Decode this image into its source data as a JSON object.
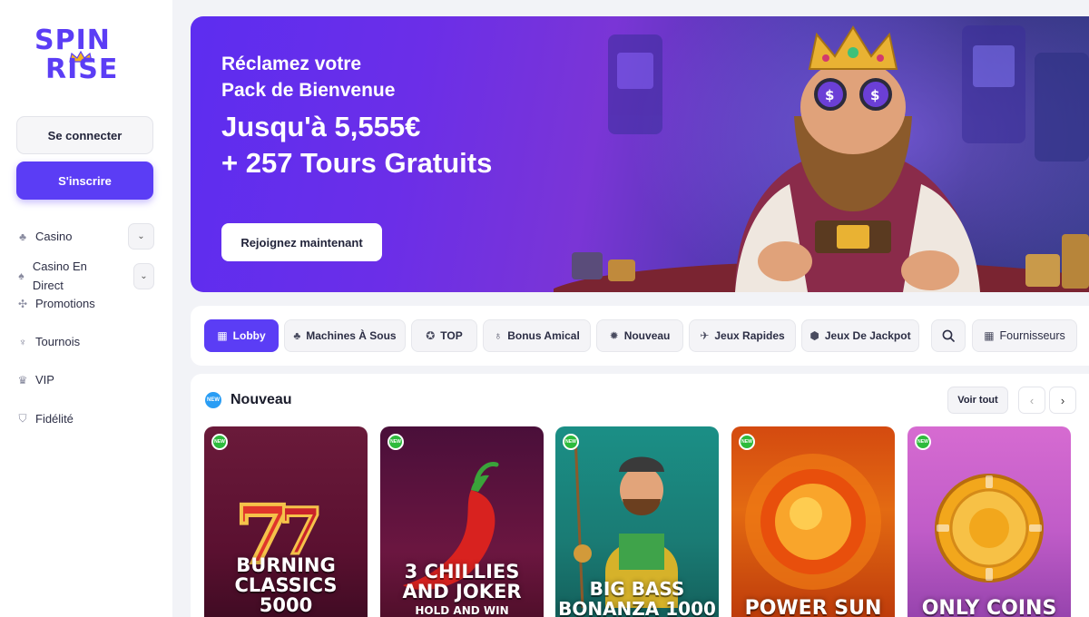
{
  "brand": {
    "line1": "SPIN",
    "line2": "RISE",
    "accent": "#5b3df5"
  },
  "auth": {
    "login_label": "Se connecter",
    "signup_label": "S'inscrire"
  },
  "sidebar": {
    "items": [
      {
        "label": "Casino",
        "icon": "cards-icon",
        "expandable": true
      },
      {
        "label": "Casino En Direct",
        "icon": "spade-icon",
        "expandable": true
      },
      {
        "label": "Promotions",
        "icon": "gift-icon",
        "expandable": false
      },
      {
        "label": "Tournois",
        "icon": "trophy-icon",
        "expandable": false
      },
      {
        "label": "VIP",
        "icon": "crown-icon",
        "expandable": false
      },
      {
        "label": "Fidélité",
        "icon": "shield-icon",
        "expandable": false
      }
    ]
  },
  "hero": {
    "line1": "Réclamez votre",
    "line2": "Pack de Bienvenue",
    "offer1": "Jusqu'à 5,555€",
    "offer2": "+ 257 Tours Gratuits",
    "cta_label": "Rejoignez maintenant"
  },
  "categories": {
    "tabs": [
      {
        "label": "Lobby",
        "icon": "lobby-icon",
        "active": true
      },
      {
        "label": "Machines À Sous",
        "icon": "cherry-icon",
        "active": false
      },
      {
        "label": "TOP",
        "icon": "medal-icon",
        "active": false
      },
      {
        "label": "Bonus Amical",
        "icon": "moneybag-icon",
        "active": false
      },
      {
        "label": "Nouveau",
        "icon": "new-icon",
        "active": false
      },
      {
        "label": "Jeux Rapides",
        "icon": "plane-icon",
        "active": false
      },
      {
        "label": "Jeux De Jackpot",
        "icon": "jackpot-icon",
        "active": false
      }
    ],
    "search_icon": "search-icon",
    "providers_label": "Fournisseurs"
  },
  "new_section": {
    "title": "Nouveau",
    "badge_text": "NEW",
    "see_all_label": "Voir tout",
    "games": [
      {
        "title_lines": [
          "BURNING",
          "CLASSICS",
          "5000"
        ],
        "subtitle": "",
        "badge": "NEW"
      },
      {
        "title_lines": [
          "3 CHILLIES",
          "AND JOKER"
        ],
        "subtitle": "HOLD AND WIN",
        "badge": "NEW"
      },
      {
        "title_lines": [
          "BIG BASS",
          "BONANZA 1000"
        ],
        "subtitle": "",
        "badge": "NEW"
      },
      {
        "title_lines": [
          "POWER SUN"
        ],
        "subtitle": "",
        "badge": "NEW"
      },
      {
        "title_lines": [
          "ONLY COINS"
        ],
        "subtitle": "",
        "badge": "NEW"
      }
    ]
  }
}
